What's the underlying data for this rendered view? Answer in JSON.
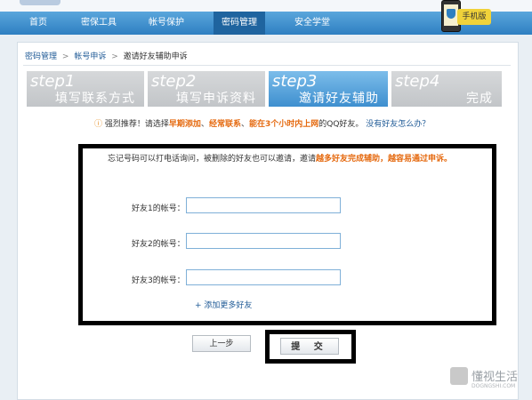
{
  "nav": {
    "items": [
      {
        "label": "首页"
      },
      {
        "label": "密保工具"
      },
      {
        "label": "帐号保护"
      },
      {
        "label": "密码管理",
        "active": true
      },
      {
        "label": "安全学堂"
      }
    ],
    "phone_badge": "手机版"
  },
  "breadcrumb": [
    "密码管理",
    "帐号申诉",
    "邀请好友辅助申诉"
  ],
  "steps": [
    {
      "num": "step1",
      "label": "填写联系方式",
      "active": false
    },
    {
      "num": "step2",
      "label": "填写申诉资料",
      "active": false
    },
    {
      "num": "step3",
      "label": "邀请好友辅助",
      "active": true
    },
    {
      "num": "step4",
      "label": "完成",
      "active": false
    }
  ],
  "tip": {
    "icon": "!",
    "p1": "强烈推荐！请选择",
    "h1": "早期添加",
    "s1": "、",
    "h2": "经常联系",
    "s2": "、",
    "h3": "能在3个小时内上网",
    "p2": "的QQ好友。",
    "link": "没有好友怎么办？"
  },
  "note": {
    "text": "忘记号码可以打电话询问，被删除的好友也可以邀请，邀请",
    "highlight": "越多好友完成辅助，越容易通过申诉。"
  },
  "fields": [
    {
      "label": "好友1的帐号：",
      "value": ""
    },
    {
      "label": "好友2的帐号：",
      "value": ""
    },
    {
      "label": "好友3的帐号：",
      "value": ""
    }
  ],
  "add_more": "+ 添加更多好友",
  "buttons": {
    "prev": "上一步",
    "submit": "提 交"
  },
  "watermark": {
    "title": "懂视生活",
    "sub": "DOGNGSHI.COM"
  },
  "colors": {
    "nav": "#2e7fc1",
    "active_step": "#3e8fcf",
    "highlight": "#e56a10",
    "link": "#1f5a96"
  }
}
